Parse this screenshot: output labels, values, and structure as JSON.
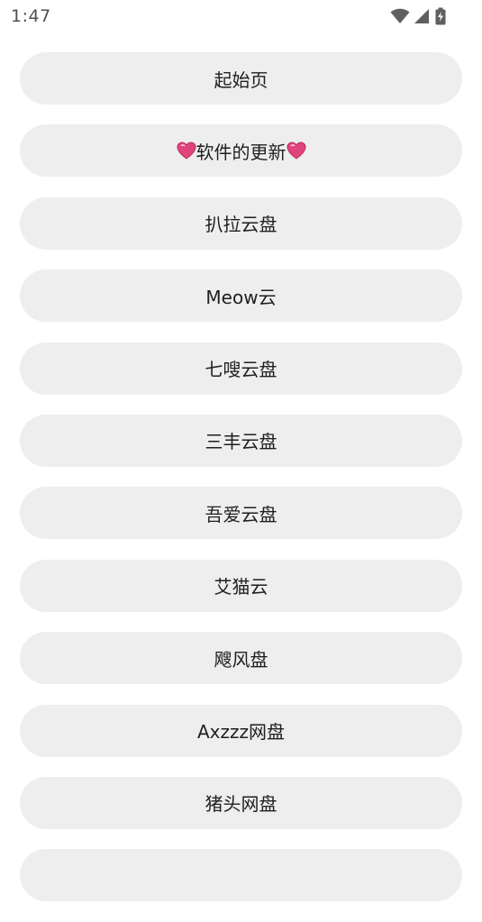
{
  "status_bar": {
    "time": "1:47",
    "icons": [
      "wifi-icon",
      "cell-signal-icon",
      "battery-charging-icon"
    ]
  },
  "list": {
    "items": [
      {
        "label": "起始页"
      },
      {
        "label": "软件的更新",
        "decor": "heart-icon"
      },
      {
        "label": "扒拉云盘"
      },
      {
        "label": "Meow云"
      },
      {
        "label": "七嗖云盘"
      },
      {
        "label": "三丰云盘"
      },
      {
        "label": "吾爱云盘"
      },
      {
        "label": "艾猫云"
      },
      {
        "label": "飕风盘"
      },
      {
        "label": "Axzzz网盘"
      },
      {
        "label": "猪头网盘"
      },
      {
        "label": ""
      }
    ]
  },
  "colors": {
    "button_bg": "#eeeeee",
    "text": "#1f1f1f",
    "status_icon": "#5f5f5f",
    "heart": "#e0447c"
  }
}
